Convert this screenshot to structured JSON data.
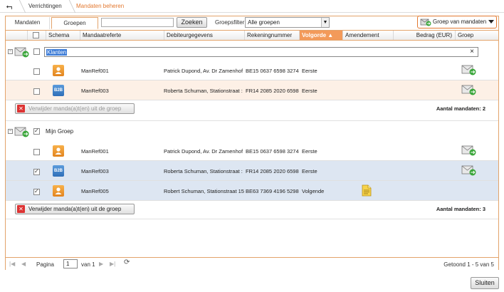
{
  "breadcrumb": {
    "back": "⮢",
    "items": [
      "Verrichtingen",
      "Mandaten beheren"
    ]
  },
  "tabs": [
    "Mandaten",
    "Groepen"
  ],
  "toolbar": {
    "search_value": "",
    "search_button": "Zoeken",
    "filter_label": "Groepsfilter",
    "filter_value": "Alle groepen",
    "group_button": "Groep van mandaten"
  },
  "columns": [
    "Schema",
    "Mandaatreferte",
    "Debiteurgegevens",
    "Rekeningnummer",
    "Volgorde ▲",
    "Amendement",
    "Bedrag (EUR)",
    "Groep"
  ],
  "groups": [
    {
      "name": "Klanten",
      "rows": [
        {
          "ref": "ManRef001",
          "debtor": "Patrick Dupond, Av. Dr Zamenhof",
          "account": "BE15 0637 6598 3274",
          "sequence": "Eerste"
        },
        {
          "ref": "ManRef003",
          "debtor": "Roberta Schuman, Stationstraat :",
          "account": "FR14 2085 2020 6598",
          "sequence": "Eerste"
        }
      ],
      "remove_button": "Verwijder manda(a)t(en) uit de groep",
      "count_text": "Aantal mandaten: 2"
    },
    {
      "name": "Mijn Groep",
      "rows": [
        {
          "ref": "ManRef001",
          "debtor": "Patrick Dupond, Av. Dr Zamenhof",
          "account": "BE15 0637 6598 3274",
          "sequence": "Eerste"
        },
        {
          "ref": "ManRef003",
          "debtor": "Roberta Schuman, Stationstraat :",
          "account": "FR14 2085 2020 6598",
          "sequence": "Eerste"
        },
        {
          "ref": "ManRef005",
          "debtor": "Robert Schuman, Stationstraat 15",
          "account": "BE63 7369 4196 5298",
          "sequence": "Volgende"
        }
      ],
      "remove_button": "Verwijder manda(a)t(en) uit de groep",
      "count_text": "Aantal mandaten: 3"
    }
  ],
  "schema_labels": {
    "b2b": "B2B"
  },
  "pager": {
    "page_label": "Pagina",
    "page_value": "1",
    "of_label": "van 1",
    "shown": "Getoond 1 - 5 van 5"
  },
  "close_button": "Sluiten"
}
